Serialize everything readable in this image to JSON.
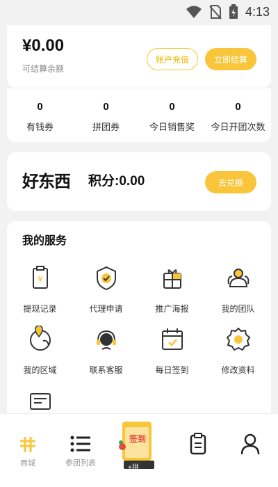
{
  "status_bar": {
    "time": "4:13"
  },
  "balance": {
    "amount": "¥0.00",
    "label": "可结算余额",
    "recharge_label": "账户充值",
    "settle_label": "立即结算"
  },
  "stats": [
    {
      "value": "0",
      "label": "有钱券"
    },
    {
      "value": "0",
      "label": "拼团券"
    },
    {
      "value": "0",
      "label": "今日销售奖"
    },
    {
      "value": "0",
      "label": "今日开团次数"
    }
  ],
  "points": {
    "logo_text": "好东西",
    "text": "积分:0.00",
    "exchange_label": "去兑换"
  },
  "services": {
    "title": "我的服务",
    "items": [
      {
        "label": "提现记录",
        "icon": "withdraw-record-icon"
      },
      {
        "label": "代理申请",
        "icon": "agent-apply-icon"
      },
      {
        "label": "推广海报",
        "icon": "gift-poster-icon"
      },
      {
        "label": "我的团队",
        "icon": "team-icon"
      },
      {
        "label": "我的区域",
        "icon": "region-icon"
      },
      {
        "label": "联系客服",
        "icon": "customer-service-icon"
      },
      {
        "label": "每日签到",
        "icon": "calendar-icon"
      },
      {
        "label": "修改资料",
        "icon": "settings-gear-icon"
      }
    ]
  },
  "tabbar": {
    "items": [
      {
        "label": "商城",
        "icon": "mall-icon"
      },
      {
        "label": "参团列表",
        "icon": "list-icon"
      },
      {
        "label": "",
        "icon": "clipboard-icon"
      },
      {
        "label": "",
        "icon": "user-icon"
      }
    ],
    "promo_text": "签到",
    "promo_sub": "+拼"
  },
  "colors": {
    "accent": "#f9c53b",
    "background": "#f2f2f2"
  }
}
